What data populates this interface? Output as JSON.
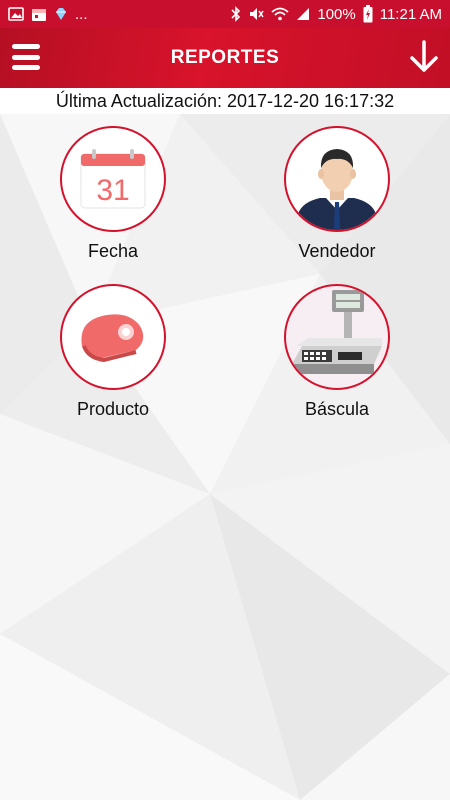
{
  "status_bar": {
    "ellipsis": "...",
    "battery": "100%",
    "time": "11:21 AM"
  },
  "toolbar": {
    "title": "REPORTES"
  },
  "last_update": {
    "text": "Última Actualización: 2017-12-20 16:17:32"
  },
  "reports": [
    {
      "label": "Fecha",
      "icon": "calendar-icon",
      "day": "31"
    },
    {
      "label": "Vendedor",
      "icon": "salesperson-icon"
    },
    {
      "label": "Producto",
      "icon": "meat-icon"
    },
    {
      "label": "Báscula",
      "icon": "scale-icon"
    }
  ],
  "colors": {
    "primary": "#c8102e",
    "accent_light": "#f06a6a",
    "background": "#f0f0f0"
  }
}
